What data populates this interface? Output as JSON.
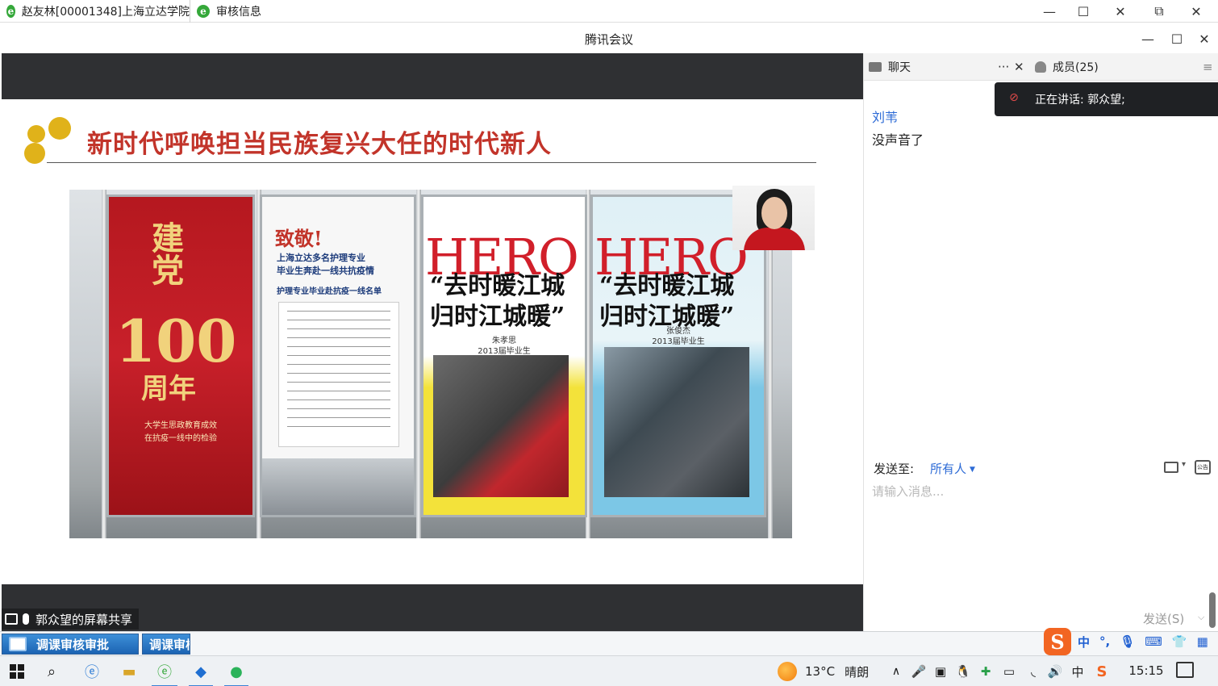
{
  "browser": {
    "tabs": [
      {
        "label": "赵友林[00001348]上海立达学院",
        "icon": "ie-icon"
      },
      {
        "label": "审核信息",
        "icon": "ie-icon"
      }
    ],
    "window_controls": {
      "minimize": "—",
      "maximize": "☐",
      "close": "✕",
      "restore": "⧉",
      "close2": "✕"
    }
  },
  "meeting": {
    "title": "腾讯会议",
    "window_controls": {
      "minimize": "—",
      "maximize": "☐",
      "close": "✕"
    }
  },
  "slide": {
    "title": "新时代呼唤担当民族复兴大任的时代新人",
    "banner1": {
      "vertical": "建党",
      "big": "100",
      "big2": "周年",
      "caption_line1": "大学生思政教育成效",
      "caption_line2": "在抗疫一线中的检验"
    },
    "banner2": {
      "heading": "致敬!",
      "sub_line1": "上海立达多名护理专业",
      "sub_line2": "毕业生奔赴一线共抗疫情",
      "list_title": "护理专业毕业赴抗疫一线名单"
    },
    "banner3": {
      "hero": "HERO",
      "calli_line1": "“去时暖江城",
      "calli_line2": "归时江城暖”",
      "name": "朱孝思",
      "year": "2013届毕业生"
    },
    "banner4": {
      "hero": "HERO",
      "calli_line1": "“去时暖江城",
      "calli_line2": "归时江城暖”",
      "name": "张俊杰",
      "year": "2013届毕业生"
    }
  },
  "share_tag": {
    "label": "郭众望的屏幕共享"
  },
  "panel": {
    "chat_tab": "聊天",
    "members_tab": "成员(25)",
    "more_icon": "···",
    "close_icon": "✕",
    "menu_icon": "≡",
    "speaking": "正在讲话: 郭众望;",
    "messages": [
      {
        "sender": "刘苇",
        "text": "没声音了"
      }
    ],
    "send_to_label": "发送至:",
    "send_to_value": "所有人",
    "input_placeholder": "请输入消息...",
    "send_button": "发送(S)",
    "notice_icon_text": "公告"
  },
  "appbar": {
    "buttons": [
      {
        "label": "调课审核审批"
      },
      {
        "label": "调课审核"
      }
    ],
    "ime_logo": "S",
    "ime_mode": "中"
  },
  "taskbar": {
    "weather_temp": "13°C",
    "weather_text": "晴朗",
    "tray_caret": "∧",
    "ime_indicator": "中",
    "time": "15:15"
  },
  "colors": {
    "accent": "#2d6bd6",
    "slide_title": "#c2342a",
    "share_band": "#2f3033"
  }
}
